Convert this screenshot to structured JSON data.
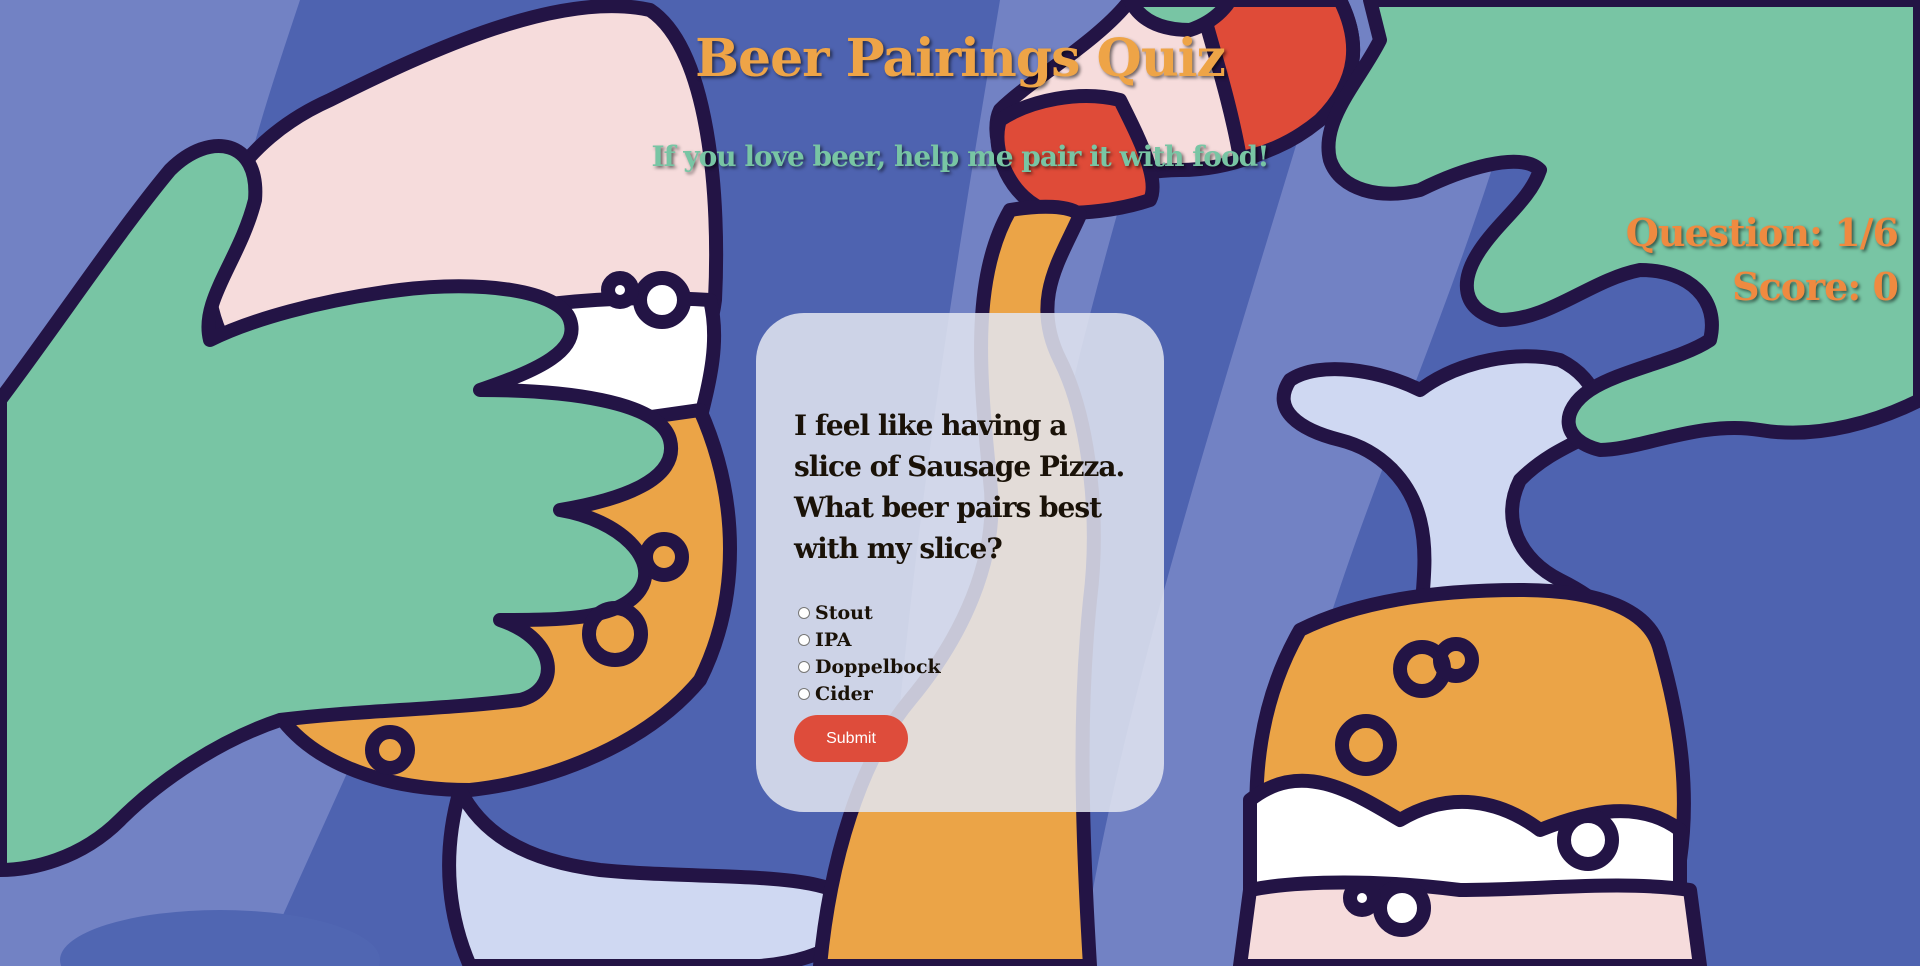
{
  "header": {
    "title": "Beer Pairings Quiz",
    "subtitle": "If you love beer, help me pair it with food!"
  },
  "stats": {
    "question_label": "Question: 1/6",
    "score_label": "Score: 0"
  },
  "quiz": {
    "question": "I feel like having a slice of Sausage Pizza. What beer pairs best with my slice?",
    "options": [
      "Stout",
      "IPA",
      "Doppelbock",
      "Cider"
    ],
    "submit_label": "Submit"
  },
  "colors": {
    "background": "#4e63b0",
    "title": "#eea447",
    "subtitle": "#78c5a4",
    "stats": "#ef8a40",
    "submit_button": "#de4c3b"
  }
}
